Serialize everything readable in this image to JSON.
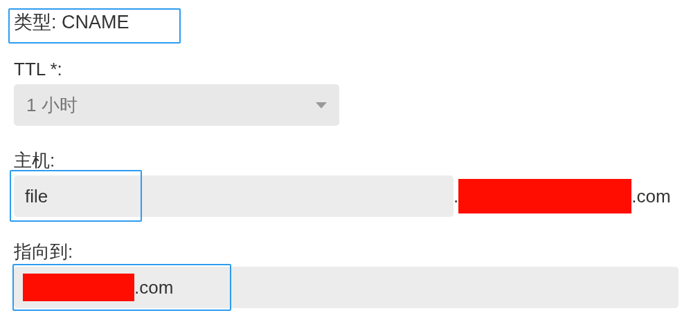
{
  "record_type": {
    "text": "类型: CNAME",
    "highlighted": true
  },
  "ttl": {
    "label": "TTL *:",
    "value": "1 小时",
    "disabled": true
  },
  "host": {
    "label": "主机:",
    "value": "file",
    "highlighted": true,
    "suffix_dot": ".",
    "suffix_redacted": true,
    "suffix_end": ".com"
  },
  "target": {
    "label": "指向到:",
    "redacted": true,
    "value_end": ".com",
    "highlighted": true
  }
}
